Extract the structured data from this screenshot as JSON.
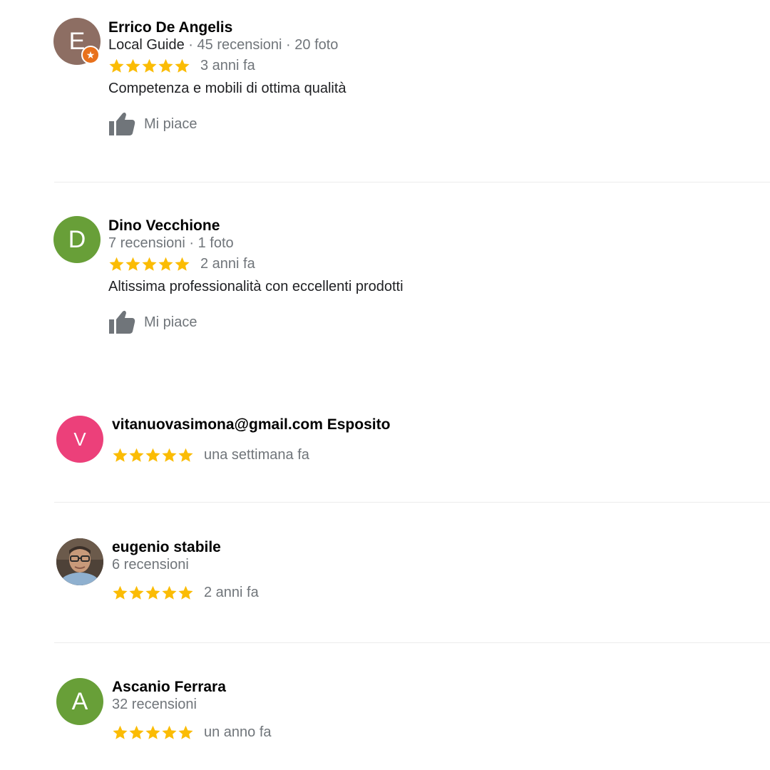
{
  "colors": {
    "star": "#fbbc04",
    "secondary_text": "#70757a",
    "divider": "#ececec",
    "local_guide_badge": "#e8711c"
  },
  "reviews": [
    {
      "initial": "E",
      "avatar_color": "#8d6e63",
      "local_guide_badge_icon": "star-badge-icon",
      "name": "Errico De Angelis",
      "local_guide": "Local Guide",
      "meta": " · 45 recensioni · 20 foto",
      "rating": 5,
      "date": "3 anni fa",
      "text": "Competenza e mobili di ottima qualità",
      "like_label": "Mi piace"
    },
    {
      "initial": "D",
      "avatar_color": "#689f38",
      "name": "Dino Vecchione",
      "meta": "7 recensioni · 1 foto",
      "rating": 5,
      "date": "2 anni fa",
      "text": "Altissima professionalità con eccellenti prodotti",
      "like_label": "Mi piace"
    },
    {
      "initial": "V",
      "avatar_color": "#ec407a",
      "name": "vitanuovasimona@gmail.com Esposito",
      "rating": 5,
      "date": "una settimana fa"
    },
    {
      "avatar_image": "profile-photo",
      "name": "eugenio stabile",
      "meta": "6 recensioni",
      "rating": 5,
      "date": "2 anni fa"
    },
    {
      "initial": "A",
      "avatar_color": "#689f38",
      "name": "Ascanio Ferrara",
      "meta": "32 recensioni",
      "rating": 5,
      "date": "un anno fa"
    }
  ]
}
